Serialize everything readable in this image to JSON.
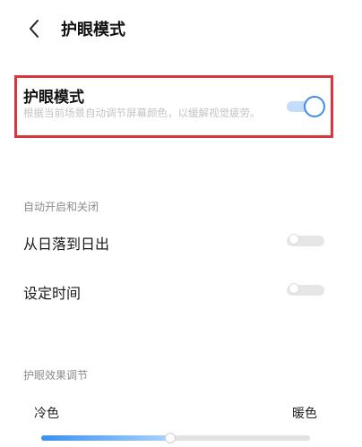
{
  "header": {
    "title": "护眼模式",
    "back_icon": "chevron-left-icon"
  },
  "eye_mode": {
    "title": "护眼模式",
    "description": "根据当前场景自动调节屏幕颜色，以缓解视觉疲劳。",
    "enabled": true,
    "accent_color": "#3b8df0"
  },
  "auto_section": {
    "label": "自动开启和关闭",
    "items": [
      {
        "label": "从日落到日出",
        "enabled": false
      },
      {
        "label": "设定时间",
        "enabled": false
      }
    ]
  },
  "effect_section": {
    "label": "护眼效果调节",
    "cool_label": "冷色",
    "warm_label": "暖色",
    "level": 0.48
  }
}
